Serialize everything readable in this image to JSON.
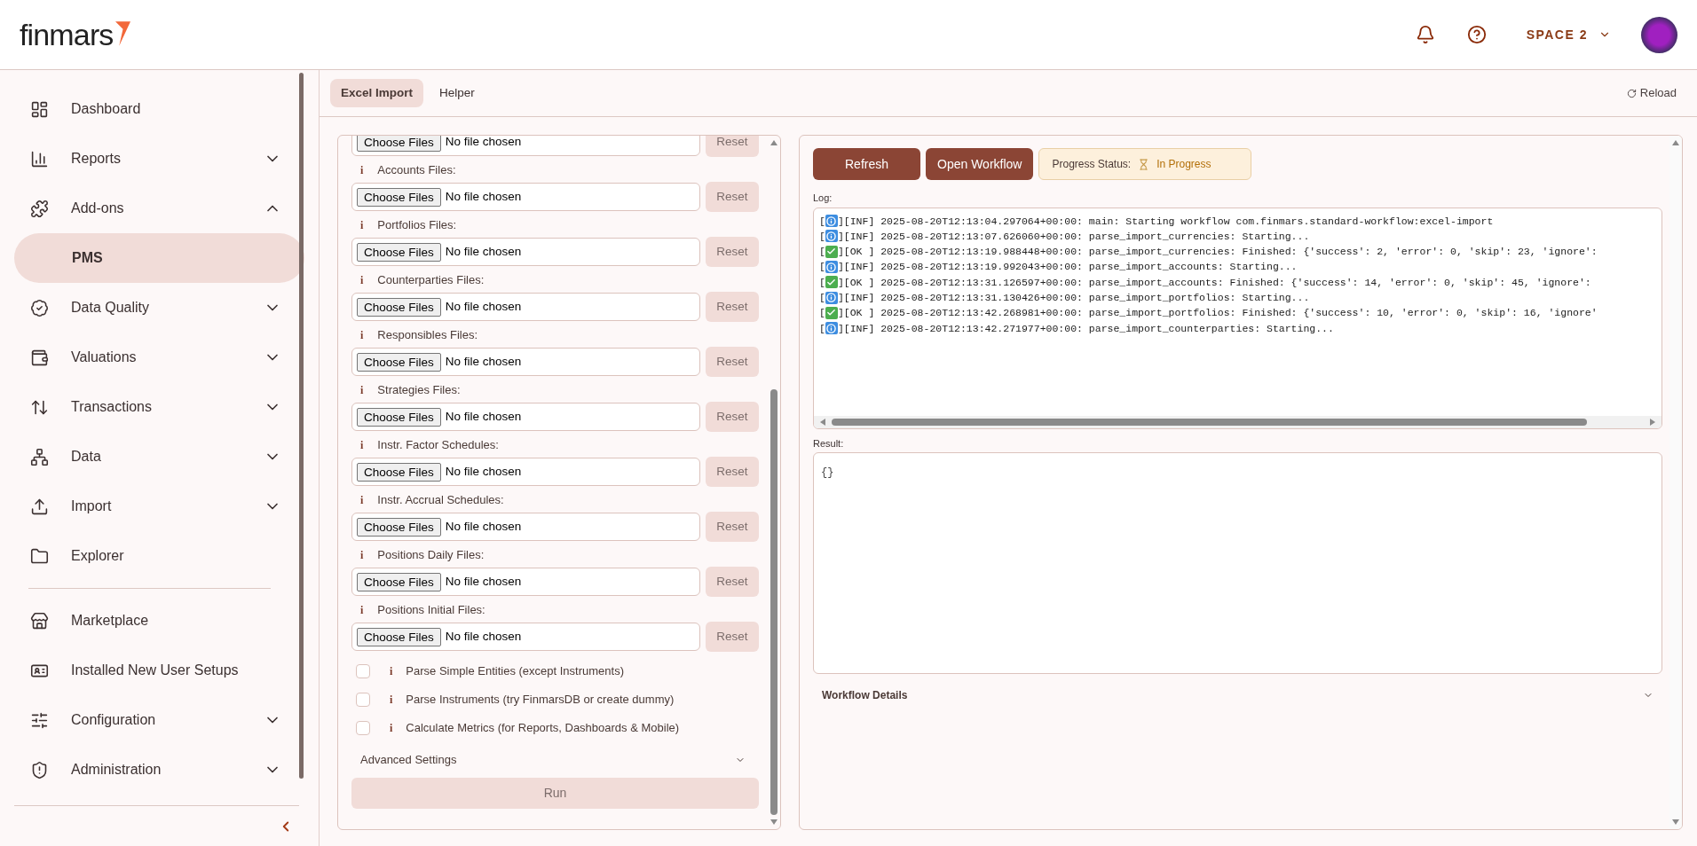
{
  "header": {
    "logo": "finmars",
    "space": "SPACE 2"
  },
  "sidebar": {
    "sections": [
      [
        {
          "label": "Dashboard",
          "kind": "link"
        },
        {
          "label": "Reports",
          "kind": "group",
          "expanded": false
        },
        {
          "label": "Add-ons",
          "kind": "group",
          "expanded": true,
          "children": [
            {
              "label": "PMS",
              "selected": true
            }
          ]
        },
        {
          "label": "Data Quality",
          "kind": "group",
          "expanded": false
        },
        {
          "label": "Valuations",
          "kind": "group",
          "expanded": false
        },
        {
          "label": "Transactions",
          "kind": "group",
          "expanded": false
        },
        {
          "label": "Data",
          "kind": "group",
          "expanded": false
        },
        {
          "label": "Import",
          "kind": "group",
          "expanded": false
        },
        {
          "label": "Explorer",
          "kind": "link"
        }
      ],
      [
        {
          "label": "Marketplace",
          "kind": "link"
        },
        {
          "label": "Installed New User Setups",
          "kind": "link"
        },
        {
          "label": "Configuration",
          "kind": "group",
          "expanded": false
        },
        {
          "label": "Administration",
          "kind": "group",
          "expanded": false
        }
      ]
    ]
  },
  "tabs": [
    {
      "label": "Excel Import",
      "selected": true
    },
    {
      "label": "Helper",
      "selected": false
    }
  ],
  "reload": "Reload",
  "form": {
    "files": [
      {
        "button": "Choose Files",
        "status": "No file chosen",
        "reset": "Reset"
      },
      {
        "info": "i",
        "label": "Accounts Files:",
        "button": "Choose Files",
        "status": "No file chosen",
        "reset": "Reset"
      },
      {
        "info": "i",
        "label": "Portfolios Files:",
        "button": "Choose Files",
        "status": "No file chosen",
        "reset": "Reset"
      },
      {
        "info": "i",
        "label": "Counterparties Files:",
        "button": "Choose Files",
        "status": "No file chosen",
        "reset": "Reset"
      },
      {
        "info": "i",
        "label": "Responsibles Files:",
        "button": "Choose Files",
        "status": "No file chosen",
        "reset": "Reset"
      },
      {
        "info": "i",
        "label": "Strategies Files:",
        "button": "Choose Files",
        "status": "No file chosen",
        "reset": "Reset"
      },
      {
        "info": "i",
        "label": "Instr. Factor Schedules:",
        "button": "Choose Files",
        "status": "No file chosen",
        "reset": "Reset"
      },
      {
        "info": "i",
        "label": "Instr. Accrual Schedules:",
        "button": "Choose Files",
        "status": "No file chosen",
        "reset": "Reset"
      },
      {
        "info": "i",
        "label": "Positions Daily Files:",
        "button": "Choose Files",
        "status": "No file chosen",
        "reset": "Reset"
      },
      {
        "info": "i",
        "label": "Positions Initial Files:",
        "button": "Choose Files",
        "status": "No file chosen",
        "reset": "Reset"
      }
    ],
    "options": [
      {
        "info": "i",
        "label": "Parse Simple Entities (except Instruments)",
        "checked": false
      },
      {
        "info": "i",
        "label": "Parse Instruments (try FinmarsDB or create dummy)",
        "checked": false
      },
      {
        "info": "i",
        "label": "Calculate Metrics (for Reports, Dashboards & Mobile)",
        "checked": false
      }
    ],
    "advanced": "Advanced Settings",
    "run": "Run"
  },
  "workflow": {
    "refresh": "Refresh",
    "open": "Open Workflow",
    "status_label": "Progress Status:",
    "status": "In Progress",
    "log_label": "Log:",
    "log": [
      {
        "kind": "info",
        "open": "[",
        "text": "][INF] 2025-08-20T12:13:04.297064+00:00: main: Starting workflow com.finmars.standard-workflow:excel-import"
      },
      {
        "kind": "info",
        "open": "[",
        "text": "][INF] 2025-08-20T12:13:07.626060+00:00: parse_import_currencies: Starting..."
      },
      {
        "kind": "ok",
        "open": "[",
        "text": "][OK ] 2025-08-20T12:13:19.988448+00:00: parse_import_currencies: Finished: {'success': 2, 'error': 0, 'skip': 23, 'ignore':"
      },
      {
        "kind": "info",
        "open": "[",
        "text": "][INF] 2025-08-20T12:13:19.992043+00:00: parse_import_accounts: Starting..."
      },
      {
        "kind": "ok",
        "open": "[",
        "text": "][OK ] 2025-08-20T12:13:31.126597+00:00: parse_import_accounts: Finished: {'success': 14, 'error': 0, 'skip': 45, 'ignore':"
      },
      {
        "kind": "info",
        "open": "[",
        "text": "][INF] 2025-08-20T12:13:31.130426+00:00: parse_import_portfolios: Starting..."
      },
      {
        "kind": "ok",
        "open": "[",
        "text": "][OK ] 2025-08-20T12:13:42.268981+00:00: parse_import_portfolios: Finished: {'success': 10, 'error': 0, 'skip': 16, 'ignore'"
      },
      {
        "kind": "info",
        "open": "[",
        "text": "][INF] 2025-08-20T12:13:42.271977+00:00: parse_import_counterparties: Starting..."
      }
    ],
    "result_label": "Result:",
    "result": "{}",
    "details": "Workflow Details"
  }
}
